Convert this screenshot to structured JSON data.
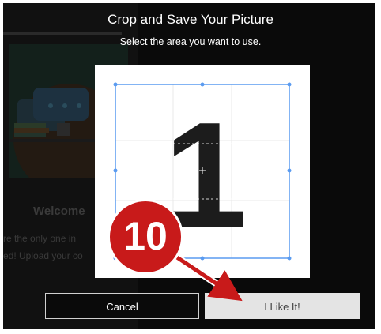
{
  "dialog": {
    "title": "Crop and Save Your Picture",
    "subtitle": "Select the area you want to use."
  },
  "crop": {
    "image_text": "1"
  },
  "buttons": {
    "cancel_label": "Cancel",
    "accept_label": "I Like It!"
  },
  "background_page": {
    "heading": "Welcome",
    "line1": "re the only one in",
    "line2": "ed! Upload your co"
  },
  "annotation": {
    "step_number": "10",
    "color": "#c81a1a"
  },
  "colors": {
    "crop_handle": "#5a9bf0",
    "dialog_bg": "#0a0a0a"
  }
}
